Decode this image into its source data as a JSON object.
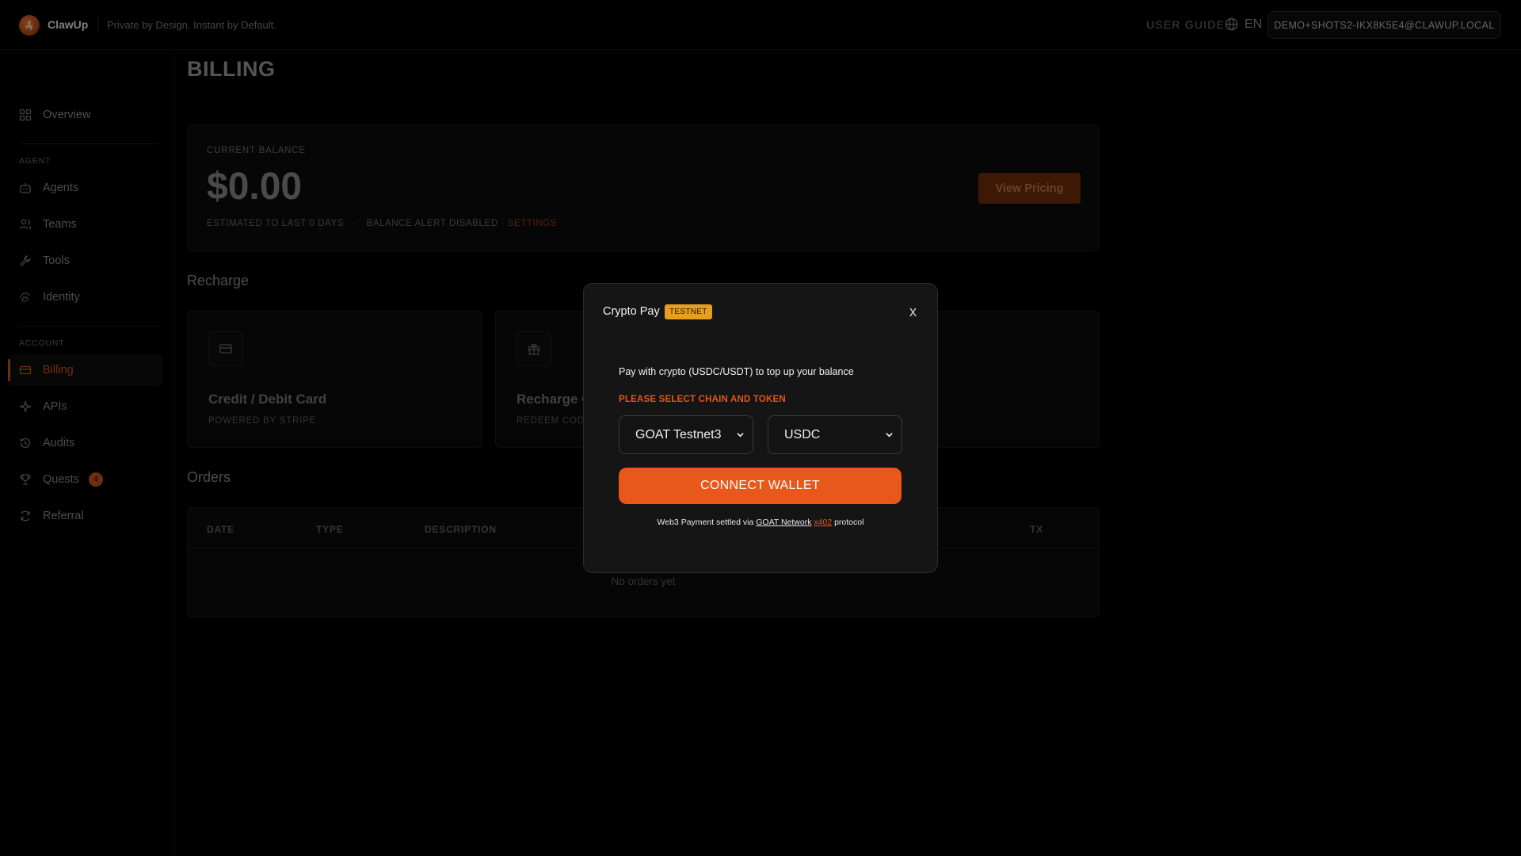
{
  "app": {
    "brand": "ClawUp",
    "tagline": "Private by Design. Instant by Default.",
    "user_guide": "USER GUIDE",
    "language": "EN",
    "user_email": "DEMO+SHOTS2-IKX8K5E4@CLAWUP.LOCAL"
  },
  "sidebar": {
    "overview": "Overview",
    "agent_section": "AGENT",
    "agent_items": [
      "Agents",
      "Teams",
      "Tools",
      "Identity"
    ],
    "account_section": "ACCOUNT",
    "account_items": [
      "Billing",
      "APIs",
      "Audits",
      "Quests",
      "Referral"
    ],
    "quests_badge": "4",
    "active_item": "Billing"
  },
  "main": {
    "title": "BILLING",
    "balance": {
      "label": "CURRENT BALANCE",
      "amount": "$0.00",
      "estimate": "ESTIMATED TO LAST 0 DAYS",
      "separator": "·",
      "alert": "BALANCE ALERT DISABLED ·",
      "settings_link": "SETTINGS",
      "view_pricing": "View Pricing"
    },
    "recharge": {
      "heading": "Recharge",
      "cards": [
        {
          "title": "Credit / Debit Card",
          "subtitle": "POWERED BY STRIPE"
        },
        {
          "title": "Recharge C",
          "subtitle": "REDEEM COD"
        }
      ]
    },
    "orders": {
      "heading": "Orders",
      "columns": [
        "DATE",
        "TYPE",
        "DESCRIPTION",
        "TX"
      ],
      "empty": "No orders yet"
    }
  },
  "modal": {
    "title": "Crypto Pay",
    "tag": "TESTNET",
    "close": "x",
    "description": "Pay with crypto (USDC/USDT) to top up your balance",
    "warning": "PLEASE SELECT CHAIN AND TOKEN",
    "chain": "GOAT Testnet3",
    "token": "USDC",
    "connect": "CONNECT WALLET",
    "footer_prefix": "Web3 Payment settled via",
    "footer_network": "GOAT Network",
    "footer_protocol_name": "x402",
    "footer_suffix": "protocol"
  },
  "colors": {
    "accent": "#e8581b",
    "testnet_tag": "#e89d1f",
    "background": "#000000"
  }
}
